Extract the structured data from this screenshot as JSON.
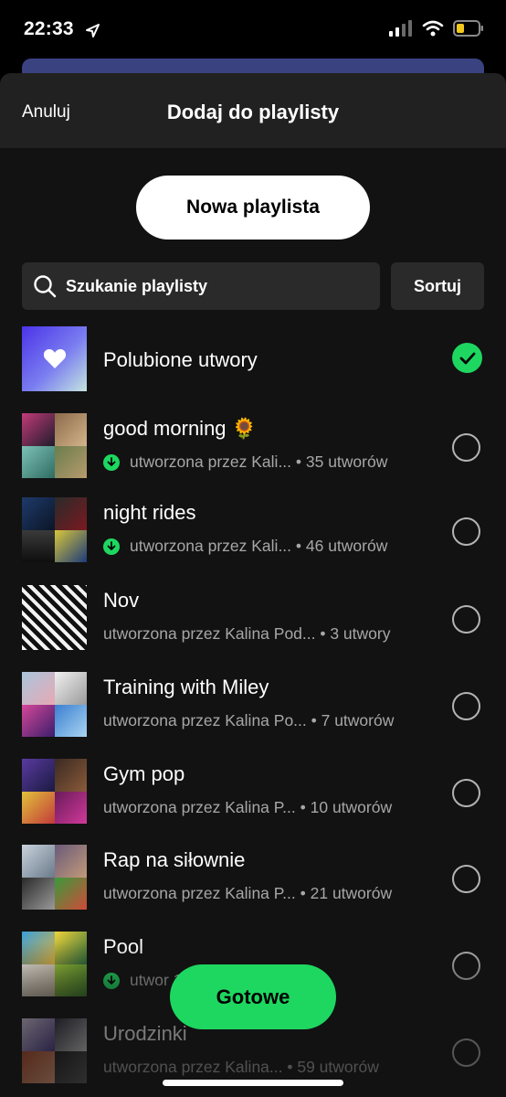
{
  "status_bar": {
    "time": "22:33"
  },
  "header": {
    "cancel_label": "Anuluj",
    "title": "Dodaj do playlisty"
  },
  "new_playlist_label": "Nowa playlista",
  "search": {
    "placeholder": "Szukanie playlisty"
  },
  "sort_label": "Sortuj",
  "colors": {
    "accent": "#1ed760",
    "background": "#121212",
    "header": "#212121"
  },
  "playlists": [
    {
      "title": "Polubione utwory",
      "subtitle": "",
      "downloaded": false,
      "selected": true
    },
    {
      "title": "good morning 🌻",
      "subtitle": "utworzona przez Kali... • 35 utworów",
      "downloaded": true,
      "selected": false
    },
    {
      "title": "night rides",
      "subtitle": "utworzona przez Kali... • 46 utworów",
      "downloaded": true,
      "selected": false
    },
    {
      "title": "Nov",
      "subtitle": "utworzona przez Kalina Pod... • 3 utwory",
      "downloaded": false,
      "selected": false
    },
    {
      "title": "Training with Miley",
      "subtitle": "utworzona przez Kalina Po... • 7 utworów",
      "downloaded": false,
      "selected": false
    },
    {
      "title": "Gym pop",
      "subtitle": "utworzona przez Kalina P... • 10 utworów",
      "downloaded": false,
      "selected": false
    },
    {
      "title": "Rap na siłownie",
      "subtitle": "utworzona przez Kalina P... • 21 utworów",
      "downloaded": false,
      "selected": false
    },
    {
      "title": "Pool",
      "subtitle": "utwor 12 utworów",
      "downloaded": true,
      "selected": false
    },
    {
      "title": "Urodzinki",
      "subtitle": "utworzona przez Kalina... • 59 utworów",
      "downloaded": false,
      "selected": false
    }
  ],
  "done_label": "Gotowe"
}
